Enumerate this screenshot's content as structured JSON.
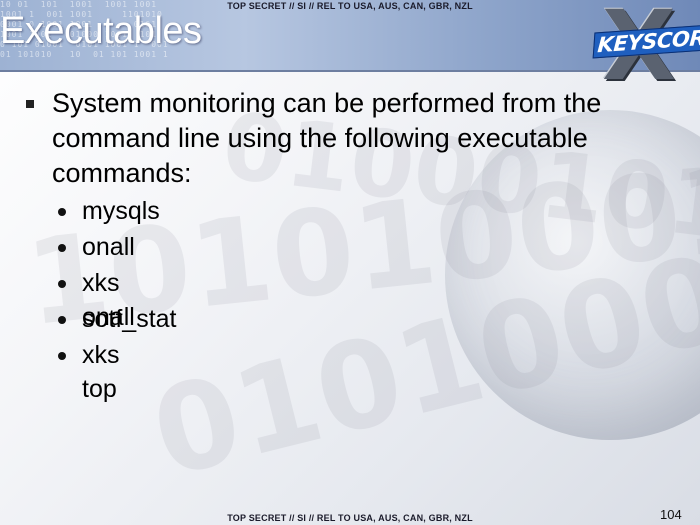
{
  "header": {
    "classification": "TOP SECRET // SI // REL TO USA, AUS, CAN, GBR, NZL",
    "title": "Executables",
    "logo_text": "KEYSCORE",
    "logo_mark": "X",
    "binary_decoration": "10 01  101  1001  1001 1001\n1001 1  001 1001     1101010\n0001 0 1001 1001       0101\n1001 1001   01000 1001  101\n0 101 01001  0101 1001 1  001\n01 101010   10  01 101 1001 1"
  },
  "content": {
    "main_bullet": "System monitoring can be performed from the command line using the following executable commands:",
    "commands": [
      "mysqls",
      "onall",
      "xks onall",
      "sotf_stat",
      "xks top"
    ]
  },
  "footer": {
    "classification": "TOP SECRET // SI // REL TO USA, AUS, CAN, GBR, NZL",
    "page_number": "104"
  },
  "decoration": {
    "watermark_1": "01000101010",
    "watermark_2": "1010100010101",
    "watermark_3": "0101000101"
  },
  "colors": {
    "banner": "#9db2d3",
    "logo_blue": "#1f5fbf",
    "text": "#000000"
  }
}
